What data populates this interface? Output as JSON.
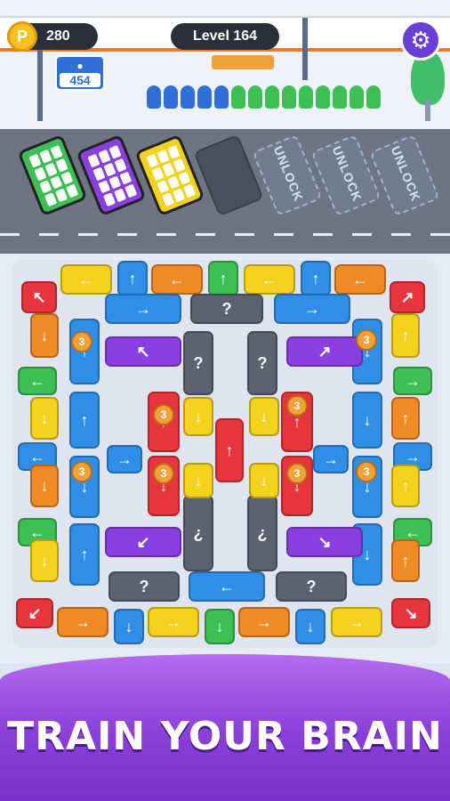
{
  "hud": {
    "coin_symbol": "P",
    "coins": "280",
    "level_label": "Level 164",
    "settings_icon": "gear-icon",
    "passenger_count": "454"
  },
  "parking_slots": [
    {
      "state": "filled",
      "color": "#3dbf55"
    },
    {
      "state": "filled",
      "color": "#8a3fe0"
    },
    {
      "state": "filled",
      "color": "#f2d21c"
    },
    {
      "state": "empty"
    },
    {
      "state": "locked",
      "label": "UNLOCK"
    },
    {
      "state": "locked",
      "label": "UNLOCK"
    },
    {
      "state": "locked",
      "label": "UNLOCK"
    }
  ],
  "queue_colors": [
    "#2f6fd6",
    "#2f6fd6",
    "#2f6fd6",
    "#2f6fd6",
    "#2f6fd6",
    "#3dbf55",
    "#3dbf55",
    "#3dbf55",
    "#3dbf55",
    "#3dbf55",
    "#3dbf55",
    "#3dbf55",
    "#3dbf55",
    "#3dbf55"
  ],
  "lock_number": "3",
  "mystery_mark": "?",
  "footer": {
    "tagline": "TRAIN YOUR BRAIN"
  },
  "colors": {
    "red": "#e8343c",
    "orange": "#f08a24",
    "yellow": "#f2d21c",
    "green": "#3dbf55",
    "blue": "#2f8fe6",
    "purple": "#8a3fe0",
    "gray": "#5d6270"
  }
}
